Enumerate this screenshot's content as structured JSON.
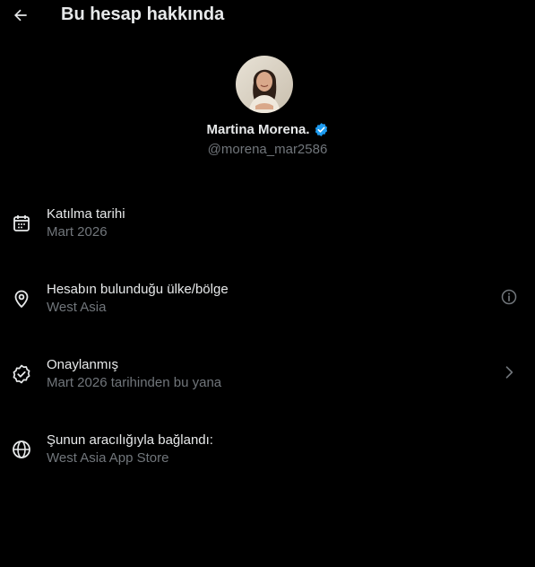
{
  "header": {
    "title": "Bu hesap hakkında",
    "back_icon": "arrow-left-icon"
  },
  "profile": {
    "display_name": "Martina Morena.",
    "handle": "@morena_mar2586",
    "verified_icon": "verified-badge-icon",
    "verified_color": "#1d9bf0"
  },
  "rows": [
    {
      "icon": "calendar-icon",
      "label": "Katılma tarihi",
      "value": "Mart 2026"
    },
    {
      "icon": "location-pin-icon",
      "label": "Hesabın bulunduğu ülke/bölge",
      "value": "West Asia",
      "action_icon": "info-icon"
    },
    {
      "icon": "verified-check-icon",
      "label": "Onaylanmış",
      "value": "Mart 2026 tarihinden bu yana",
      "action_icon": "chevron-right-icon"
    },
    {
      "icon": "globe-icon",
      "label": "Şunun aracılığıyla bağlandı:",
      "value": "West Asia App Store"
    }
  ],
  "colors": {
    "background": "#000000",
    "primary_text": "#e7e9ea",
    "secondary_text": "#71767b",
    "accent": "#1d9bf0"
  }
}
